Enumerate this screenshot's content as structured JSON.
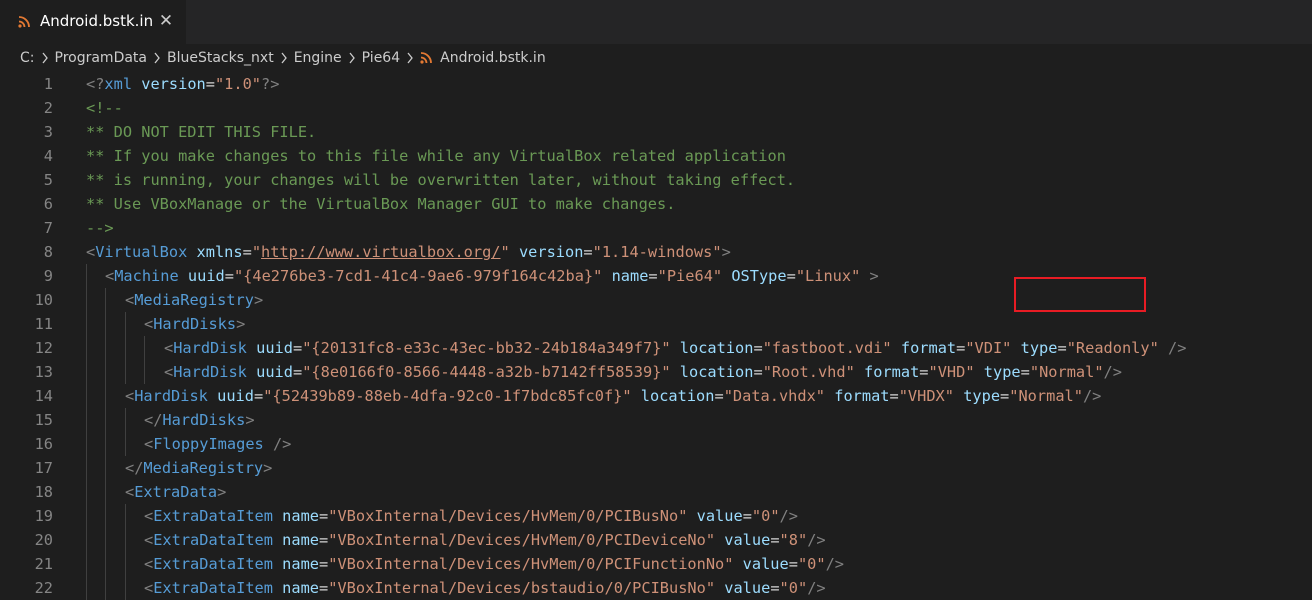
{
  "tab": {
    "title": "Android.bstk.in",
    "icon": "rss-file-icon",
    "close_glyph": "✕"
  },
  "breadcrumb": [
    "C:",
    "ProgramData",
    "BlueStacks_nxt",
    "Engine",
    "Pie64",
    "Android.bstk.in"
  ],
  "colors": {
    "background": "#1e1e1e",
    "tag": "#569cd6",
    "attribute": "#9cdcfe",
    "string": "#ce9178",
    "comment": "#6a9955",
    "punctuation": "#808080",
    "highlight_box": "#e81c24"
  },
  "lines": [
    {
      "n": "1",
      "tokens": [
        [
          "br",
          "<?"
        ],
        [
          "tag",
          "xml"
        ],
        [
          "txt",
          " "
        ],
        [
          "attr",
          "version"
        ],
        [
          "eq",
          "="
        ],
        [
          "str",
          "\"1.0\""
        ],
        [
          "br",
          "?>"
        ]
      ]
    },
    {
      "n": "2",
      "tokens": [
        [
          "cm",
          "<!--"
        ]
      ]
    },
    {
      "n": "3",
      "tokens": [
        [
          "cm",
          "** DO NOT EDIT THIS FILE."
        ]
      ]
    },
    {
      "n": "4",
      "tokens": [
        [
          "cm",
          "** If you make changes to this file while any VirtualBox related application"
        ]
      ]
    },
    {
      "n": "5",
      "tokens": [
        [
          "cm",
          "** is running, your changes will be overwritten later, without taking effect."
        ]
      ]
    },
    {
      "n": "6",
      "tokens": [
        [
          "cm",
          "** Use VBoxManage or the VirtualBox Manager GUI to make changes."
        ]
      ]
    },
    {
      "n": "7",
      "tokens": [
        [
          "cm",
          "-->"
        ]
      ]
    },
    {
      "n": "8",
      "tokens": [
        [
          "br",
          "<"
        ],
        [
          "tag",
          "VirtualBox"
        ],
        [
          "txt",
          " "
        ],
        [
          "attr",
          "xmlns"
        ],
        [
          "eq",
          "="
        ],
        [
          "str",
          "\""
        ],
        [
          "url",
          "http://www.virtualbox.org/"
        ],
        [
          "str",
          "\""
        ],
        [
          "txt",
          " "
        ],
        [
          "attr",
          "version"
        ],
        [
          "eq",
          "="
        ],
        [
          "str",
          "\"1.14-windows\""
        ],
        [
          "br",
          ">"
        ]
      ]
    },
    {
      "n": "9",
      "indent": 1,
      "tokens": [
        [
          "br",
          "<"
        ],
        [
          "tag",
          "Machine"
        ],
        [
          "txt",
          " "
        ],
        [
          "attr",
          "uuid"
        ],
        [
          "eq",
          "="
        ],
        [
          "str",
          "\"{4e276be3-7cd1-41c4-9ae6-979f164c42ba}\""
        ],
        [
          "txt",
          " "
        ],
        [
          "attr",
          "name"
        ],
        [
          "eq",
          "="
        ],
        [
          "str",
          "\"Pie64\""
        ],
        [
          "txt",
          " "
        ],
        [
          "attr",
          "OSType"
        ],
        [
          "eq",
          "="
        ],
        [
          "str",
          "\"Linux\""
        ],
        [
          "txt",
          " "
        ],
        [
          "br",
          ">"
        ]
      ]
    },
    {
      "n": "10",
      "indent": 2,
      "tokens": [
        [
          "br",
          "<"
        ],
        [
          "tag",
          "MediaRegistry"
        ],
        [
          "br",
          ">"
        ]
      ]
    },
    {
      "n": "11",
      "indent": 3,
      "tokens": [
        [
          "br",
          "<"
        ],
        [
          "tag",
          "HardDisks"
        ],
        [
          "br",
          ">"
        ]
      ]
    },
    {
      "n": "12",
      "indent": 4,
      "tokens": [
        [
          "br",
          "<"
        ],
        [
          "tag",
          "HardDisk"
        ],
        [
          "txt",
          " "
        ],
        [
          "attr",
          "uuid"
        ],
        [
          "eq",
          "="
        ],
        [
          "str",
          "\"{20131fc8-e33c-43ec-bb32-24b184a349f7}\""
        ],
        [
          "txt",
          " "
        ],
        [
          "attr",
          "location"
        ],
        [
          "eq",
          "="
        ],
        [
          "str",
          "\"fastboot.vdi\""
        ],
        [
          "txt",
          " "
        ],
        [
          "attr",
          "format"
        ],
        [
          "eq",
          "="
        ],
        [
          "str",
          "\"VDI\""
        ],
        [
          "txt",
          " "
        ],
        [
          "attr",
          "type"
        ],
        [
          "eq",
          "="
        ],
        [
          "str",
          "\"Readonly\""
        ],
        [
          "txt",
          " "
        ],
        [
          "br",
          "/>"
        ]
      ]
    },
    {
      "n": "13",
      "indent": 4,
      "tokens": [
        [
          "br",
          "<"
        ],
        [
          "tag",
          "HardDisk"
        ],
        [
          "txt",
          " "
        ],
        [
          "attr",
          "uuid"
        ],
        [
          "eq",
          "="
        ],
        [
          "str",
          "\"{8e0166f0-8566-4448-a32b-b7142ff58539}\""
        ],
        [
          "txt",
          " "
        ],
        [
          "attr",
          "location"
        ],
        [
          "eq",
          "="
        ],
        [
          "str",
          "\"Root.vhd\""
        ],
        [
          "txt",
          " "
        ],
        [
          "attr",
          "format"
        ],
        [
          "eq",
          "="
        ],
        [
          "str",
          "\"VHD\""
        ],
        [
          "txt",
          " "
        ],
        [
          "attr",
          "type"
        ],
        [
          "eq",
          "="
        ],
        [
          "str",
          "\"Normal\""
        ],
        [
          "br",
          "/>"
        ]
      ]
    },
    {
      "n": "14",
      "indent": 2,
      "tokens": [
        [
          "br",
          "<"
        ],
        [
          "tag",
          "HardDisk"
        ],
        [
          "txt",
          " "
        ],
        [
          "attr",
          "uuid"
        ],
        [
          "eq",
          "="
        ],
        [
          "str",
          "\"{52439b89-88eb-4dfa-92c0-1f7bdc85fc0f}\""
        ],
        [
          "txt",
          " "
        ],
        [
          "attr",
          "location"
        ],
        [
          "eq",
          "="
        ],
        [
          "str",
          "\"Data.vhdx\""
        ],
        [
          "txt",
          " "
        ],
        [
          "attr",
          "format"
        ],
        [
          "eq",
          "="
        ],
        [
          "str",
          "\"VHDX\""
        ],
        [
          "txt",
          " "
        ],
        [
          "attr",
          "type"
        ],
        [
          "eq",
          "="
        ],
        [
          "str",
          "\"Normal\""
        ],
        [
          "br",
          "/>"
        ]
      ]
    },
    {
      "n": "15",
      "indent": 3,
      "tokens": [
        [
          "br",
          "</"
        ],
        [
          "tag",
          "HardDisks"
        ],
        [
          "br",
          ">"
        ]
      ]
    },
    {
      "n": "16",
      "indent": 3,
      "tokens": [
        [
          "br",
          "<"
        ],
        [
          "tag",
          "FloppyImages"
        ],
        [
          "txt",
          " "
        ],
        [
          "br",
          "/>"
        ]
      ]
    },
    {
      "n": "17",
      "indent": 2,
      "tokens": [
        [
          "br",
          "</"
        ],
        [
          "tag",
          "MediaRegistry"
        ],
        [
          "br",
          ">"
        ]
      ]
    },
    {
      "n": "18",
      "indent": 2,
      "tokens": [
        [
          "br",
          "<"
        ],
        [
          "tag",
          "ExtraData"
        ],
        [
          "br",
          ">"
        ]
      ]
    },
    {
      "n": "19",
      "indent": 3,
      "tokens": [
        [
          "br",
          "<"
        ],
        [
          "tag",
          "ExtraDataItem"
        ],
        [
          "txt",
          " "
        ],
        [
          "attr",
          "name"
        ],
        [
          "eq",
          "="
        ],
        [
          "str",
          "\"VBoxInternal/Devices/HvMem/0/PCIBusNo\""
        ],
        [
          "txt",
          " "
        ],
        [
          "attr",
          "value"
        ],
        [
          "eq",
          "="
        ],
        [
          "str",
          "\"0\""
        ],
        [
          "br",
          "/>"
        ]
      ]
    },
    {
      "n": "20",
      "indent": 3,
      "tokens": [
        [
          "br",
          "<"
        ],
        [
          "tag",
          "ExtraDataItem"
        ],
        [
          "txt",
          " "
        ],
        [
          "attr",
          "name"
        ],
        [
          "eq",
          "="
        ],
        [
          "str",
          "\"VBoxInternal/Devices/HvMem/0/PCIDeviceNo\""
        ],
        [
          "txt",
          " "
        ],
        [
          "attr",
          "value"
        ],
        [
          "eq",
          "="
        ],
        [
          "str",
          "\"8\""
        ],
        [
          "br",
          "/>"
        ]
      ]
    },
    {
      "n": "21",
      "indent": 3,
      "tokens": [
        [
          "br",
          "<"
        ],
        [
          "tag",
          "ExtraDataItem"
        ],
        [
          "txt",
          " "
        ],
        [
          "attr",
          "name"
        ],
        [
          "eq",
          "="
        ],
        [
          "str",
          "\"VBoxInternal/Devices/HvMem/0/PCIFunctionNo\""
        ],
        [
          "txt",
          " "
        ],
        [
          "attr",
          "value"
        ],
        [
          "eq",
          "="
        ],
        [
          "str",
          "\"0\""
        ],
        [
          "br",
          "/>"
        ]
      ]
    },
    {
      "n": "22",
      "indent": 3,
      "tokens": [
        [
          "br",
          "<"
        ],
        [
          "tag",
          "ExtraDataItem"
        ],
        [
          "txt",
          " "
        ],
        [
          "attr",
          "name"
        ],
        [
          "eq",
          "="
        ],
        [
          "str",
          "\"VBoxInternal/Devices/bstaudio/0/PCIBusNo\""
        ],
        [
          "txt",
          " "
        ],
        [
          "attr",
          "value"
        ],
        [
          "eq",
          "="
        ],
        [
          "str",
          "\"0\""
        ],
        [
          "br",
          "/>"
        ]
      ]
    }
  ]
}
